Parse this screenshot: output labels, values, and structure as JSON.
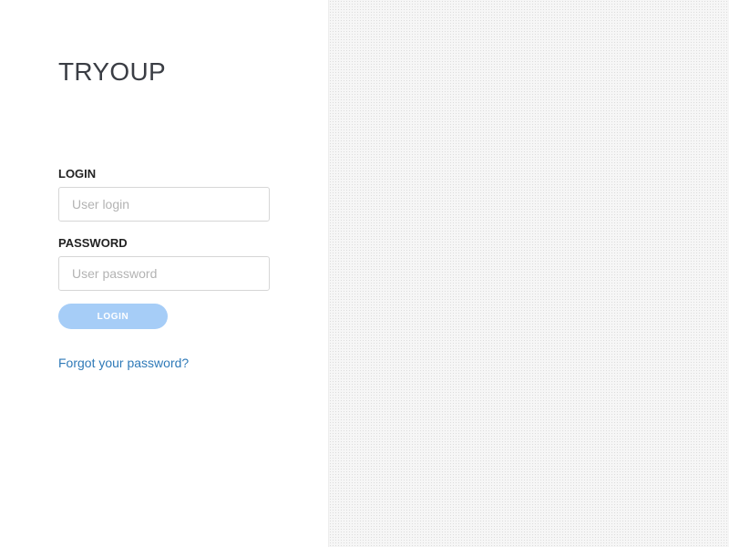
{
  "brand": {
    "logo_text": "TRYOUP"
  },
  "form": {
    "login": {
      "label": "LOGIN",
      "value": "",
      "placeholder": "User login"
    },
    "password": {
      "label": "PASSWORD",
      "value": "",
      "placeholder": "User password"
    },
    "submit_label": "LOGIN",
    "forgot_password_label": "Forgot your password?"
  },
  "colors": {
    "logo_text": "#3a3d44",
    "button_background": "#a6cdf7",
    "link": "#2f7ab8",
    "right_panel_background": "#f6f6f6"
  }
}
